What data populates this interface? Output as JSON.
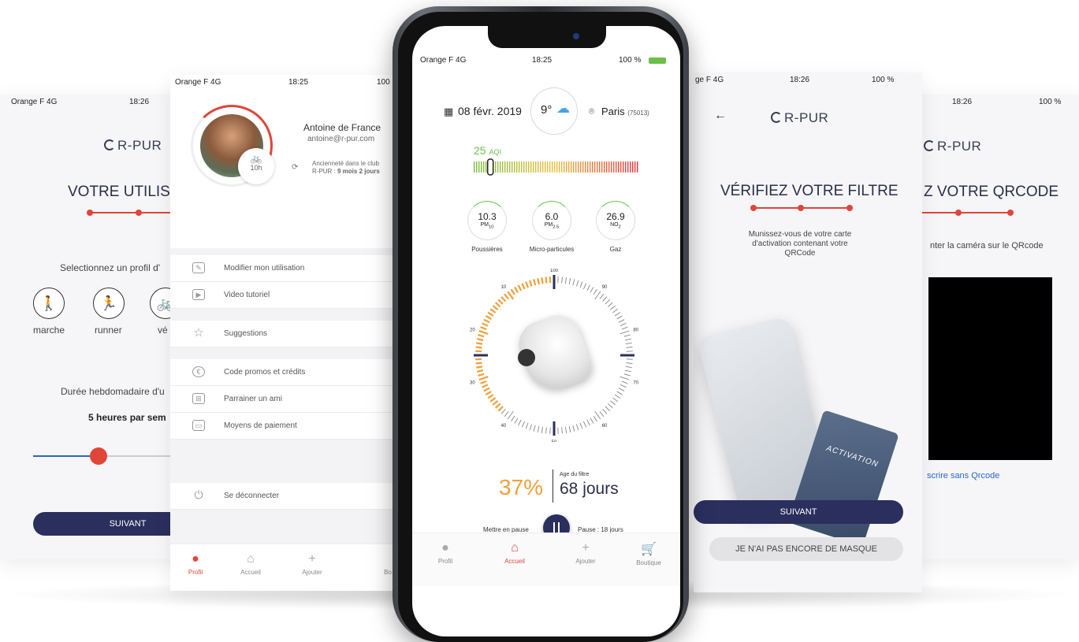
{
  "brand": {
    "name": "R-PUR"
  },
  "screen1": {
    "status": {
      "carrier": "Orange F  4G",
      "time": "18:26"
    },
    "title": "VOTRE UTILISA",
    "select_prompt": "Selectionnez un profil d'",
    "profiles": [
      {
        "label": "marche",
        "icon": "walk-icon",
        "glyph": "🚶"
      },
      {
        "label": "runner",
        "icon": "run-icon",
        "glyph": "🏃"
      },
      {
        "label": "vé",
        "icon": "bike-icon",
        "glyph": "🚲"
      }
    ],
    "weekly_label": "Durée hebdomadaire d'u",
    "weekly_value": "5 heures par sem",
    "button": "SUIVANT"
  },
  "screen2": {
    "status": {
      "carrier": "Orange F  4G",
      "time": "18:25",
      "battery": "100"
    },
    "user_name": "Antoine de France",
    "user_email": "antoine@r-pur.com",
    "seniority_label": "Ancienneté dans le club",
    "seniority_value_prefix": "R-PUR : ",
    "seniority_value": "9 mois 2 jours",
    "usage_badge": "10h",
    "menu": [
      {
        "label": "Modifier mon utilisation",
        "icon": "user-edit-icon"
      },
      {
        "label": "Video tutoriel",
        "icon": "video-icon"
      },
      {
        "label": "Suggestions",
        "icon": "star-icon"
      },
      {
        "label": "Code promos et crédits",
        "icon": "euro-icon"
      },
      {
        "label": "Parrainer un ami",
        "icon": "gift-icon"
      },
      {
        "label": "Moyens de paiement",
        "icon": "card-icon"
      },
      {
        "label": "Se déconnecter",
        "icon": "power-icon"
      }
    ],
    "tabs": [
      {
        "label": "Profil",
        "icon": "profile-icon",
        "active": true
      },
      {
        "label": "Accueil",
        "icon": "home-icon",
        "active": false
      },
      {
        "label": "Ajouter",
        "icon": "plus-icon",
        "active": false
      },
      {
        "label": "Bo",
        "icon": "cart-icon",
        "active": false
      }
    ]
  },
  "phone": {
    "status": {
      "carrier": "Orange F  4G",
      "time": "18:25",
      "battery": "100 %"
    },
    "date": "08 févr. 2019",
    "temperature": "9°",
    "weather_icon": "cloud-icon",
    "location": "Paris",
    "postcode": "(75013)",
    "aqi_value": "25",
    "aqi_unit": "AQI",
    "aqi_fraction": 0.1,
    "metrics": [
      {
        "value": "10.3",
        "unit": "PM",
        "sub": "10",
        "caption": "Poussières"
      },
      {
        "value": "6.0",
        "unit": "PM",
        "sub": "2.5",
        "caption": "Micro-particules"
      },
      {
        "value": "26.9",
        "unit": "NO",
        "sub": "2",
        "caption": "Gaz"
      }
    ],
    "dial_labels": [
      "100",
      "90",
      "80",
      "70",
      "60",
      "50",
      "40",
      "30",
      "20",
      "10"
    ],
    "filter_percent": 37,
    "filter_percent_text": "37%",
    "filter_age_label": "Age du filtre",
    "filter_age_value": "68 jours",
    "pause_left": "Mettre en pause",
    "pause_right": "Pause : 18 jours",
    "tabs": [
      {
        "label": "Profil",
        "icon": "profile-icon",
        "active": false
      },
      {
        "label": "Accueil",
        "icon": "home-icon",
        "active": true
      },
      {
        "label": "Ajouter",
        "icon": "plus-icon",
        "active": false
      },
      {
        "label": "Boutique",
        "icon": "cart-icon",
        "active": false
      }
    ]
  },
  "screen4": {
    "status": {
      "carrier": "ge F  4G",
      "time": "18:26",
      "battery": "100 %"
    },
    "title": "VÉRIFIEZ VOTRE FILTRE",
    "instructions": "Munissez-vous de votre carte d'activation contenant votre QRCode",
    "card_text": "ACTIVATION",
    "button_primary": "SUIVANT",
    "button_secondary": "JE N'AI PAS ENCORE DE MASQUE"
  },
  "screen5": {
    "status": {
      "time": "18:26",
      "battery": "100 %"
    },
    "title": "Z VOTRE QRCODE",
    "instructions": "nter la caméra sur le QRcode",
    "link": "scrire sans Qrcode"
  }
}
